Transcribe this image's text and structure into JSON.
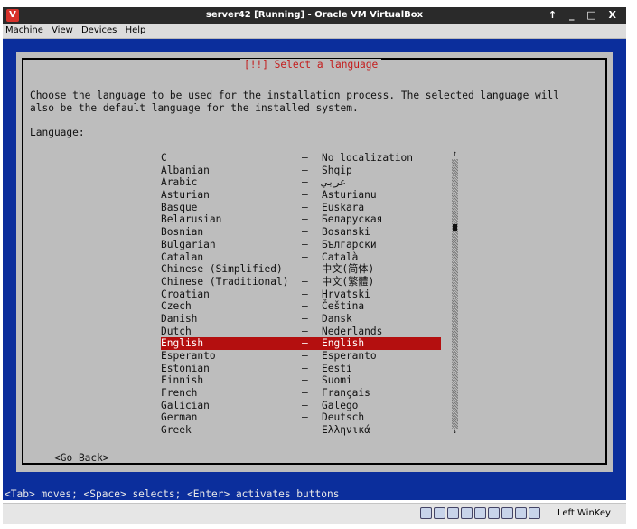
{
  "window": {
    "title": "server42 [Running] - Oracle VM VirtualBox",
    "app_icon": "virtualbox-icon",
    "controls": "↑ _ □ X"
  },
  "menu": {
    "items": [
      "Machine",
      "View",
      "Devices",
      "Help"
    ]
  },
  "dialog": {
    "title": "[!!] Select a language",
    "description_line1": "Choose the language to be used for the installation process. The selected language will",
    "description_line2": "also be the default language for the installed system.",
    "label": "Language:",
    "languages": [
      {
        "name": "C",
        "native": "No localization"
      },
      {
        "name": "Albanian",
        "native": "Shqip"
      },
      {
        "name": "Arabic",
        "native": "عربي"
      },
      {
        "name": "Asturian",
        "native": "Asturianu"
      },
      {
        "name": "Basque",
        "native": "Euskara"
      },
      {
        "name": "Belarusian",
        "native": "Беларуская"
      },
      {
        "name": "Bosnian",
        "native": "Bosanski"
      },
      {
        "name": "Bulgarian",
        "native": "Български"
      },
      {
        "name": "Catalan",
        "native": "Català"
      },
      {
        "name": "Chinese (Simplified)",
        "native": "中文(简体)"
      },
      {
        "name": "Chinese (Traditional)",
        "native": "中文(繁體)"
      },
      {
        "name": "Croatian",
        "native": "Hrvatski"
      },
      {
        "name": "Czech",
        "native": "Čeština"
      },
      {
        "name": "Danish",
        "native": "Dansk"
      },
      {
        "name": "Dutch",
        "native": "Nederlands"
      },
      {
        "name": "English",
        "native": "English"
      },
      {
        "name": "Esperanto",
        "native": "Esperanto"
      },
      {
        "name": "Estonian",
        "native": "Eesti"
      },
      {
        "name": "Finnish",
        "native": "Suomi"
      },
      {
        "name": "French",
        "native": "Français"
      },
      {
        "name": "Galician",
        "native": "Galego"
      },
      {
        "name": "German",
        "native": "Deutsch"
      },
      {
        "name": "Greek",
        "native": "Ελληνικά"
      }
    ],
    "selected_index": 15,
    "dash": "–",
    "scroll_up": "↑",
    "scroll_down": "↓",
    "go_back": "<Go Back>"
  },
  "help_bar": "<Tab> moves; <Space> selects; <Enter> activates buttons",
  "status_bar": {
    "host_key": "Left WinKey",
    "icons": [
      "hard-disk-icon",
      "optical-drive-icon",
      "network-icon",
      "usb-icon",
      "shared-folder-icon",
      "display-icon",
      "video-capture-icon",
      "mouse-integration-icon",
      "host-key-icon"
    ]
  },
  "colors": {
    "screen": "#0b2e9c",
    "dialog": "#bdbdbd",
    "title_red": "#c41c1c",
    "selection": "#b40f0f"
  }
}
